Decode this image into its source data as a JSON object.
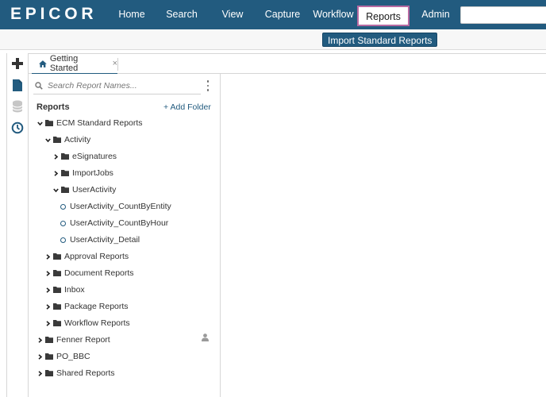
{
  "nav": {
    "logo": "EPICOR",
    "items": [
      {
        "label": "Home",
        "active": false
      },
      {
        "label": "Search",
        "active": false
      },
      {
        "label": "View",
        "active": false
      },
      {
        "label": "Capture",
        "active": false
      },
      {
        "label": "Workflow",
        "active": false
      },
      {
        "label": "Reports",
        "active": true
      },
      {
        "label": "Admin",
        "active": false
      }
    ]
  },
  "subheader": {
    "import_label": "Import Standard Reports"
  },
  "tab": {
    "label": "Getting Started",
    "close": "×"
  },
  "panel": {
    "search_placeholder": "Search Report Names...",
    "header": "Reports",
    "add_folder": "+ Add Folder"
  },
  "tree": [
    {
      "label": "ECM Standard Reports",
      "level": 0,
      "kind": "folder",
      "expanded": true
    },
    {
      "label": "Activity",
      "level": 1,
      "kind": "folder",
      "expanded": true
    },
    {
      "label": "eSignatures",
      "level": 2,
      "kind": "folder",
      "expanded": false
    },
    {
      "label": "ImportJobs",
      "level": 2,
      "kind": "folder",
      "expanded": false
    },
    {
      "label": "UserActivity",
      "level": 2,
      "kind": "folder",
      "expanded": true
    },
    {
      "label": "UserActivity_CountByEntity",
      "level": 3,
      "kind": "report"
    },
    {
      "label": "UserActivity_CountByHour",
      "level": 3,
      "kind": "report"
    },
    {
      "label": "UserActivity_Detail",
      "level": 3,
      "kind": "report"
    },
    {
      "label": "Approval Reports",
      "level": 1,
      "kind": "folder",
      "expanded": false
    },
    {
      "label": "Document Reports",
      "level": 1,
      "kind": "folder",
      "expanded": false
    },
    {
      "label": "Inbox",
      "level": 1,
      "kind": "folder",
      "expanded": false
    },
    {
      "label": "Package Reports",
      "level": 1,
      "kind": "folder",
      "expanded": false
    },
    {
      "label": "Workflow Reports",
      "level": 1,
      "kind": "folder",
      "expanded": false
    },
    {
      "label": "Fenner Report",
      "level": 0,
      "kind": "folder",
      "expanded": false,
      "shared_user": true
    },
    {
      "label": "PO_BBC",
      "level": 0,
      "kind": "folder",
      "expanded": false
    },
    {
      "label": "Shared Reports",
      "level": 0,
      "kind": "folder",
      "expanded": false
    }
  ],
  "colors": {
    "brand": "#225b7f",
    "active_outline": "#b86aa2"
  }
}
